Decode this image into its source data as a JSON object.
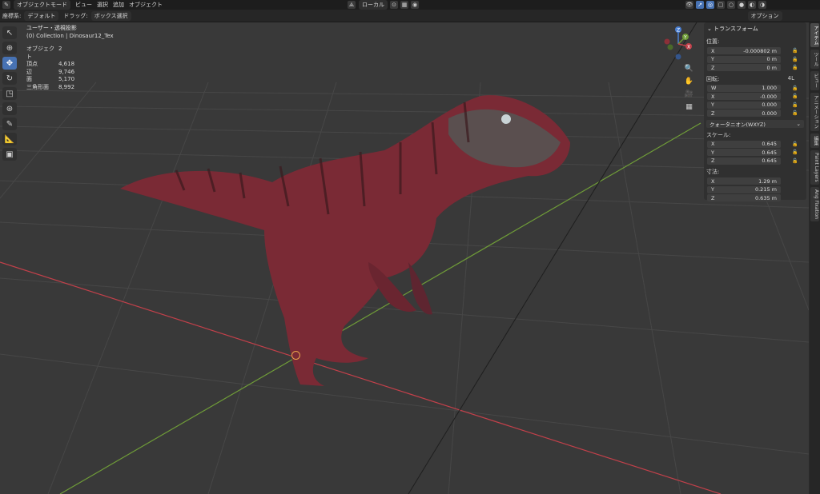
{
  "header": {
    "mode": "オブジェクトモード",
    "menus": [
      "ビュー",
      "選択",
      "追加",
      "オブジェクト"
    ],
    "orientation": "ローカル"
  },
  "header2": {
    "coord_label": "座標系:",
    "coord_value": "デフォルト",
    "drag_label": "ドラッグ:",
    "drag_value": "ボックス選択",
    "options": "オプション"
  },
  "overlay": {
    "view_name": "ユーザー・透視投影",
    "collection": "(0) Collection | Dinosaur12_Tex",
    "stats": [
      {
        "label": "オブジェクト",
        "value": "2"
      },
      {
        "label": "頂点",
        "value": "4,618"
      },
      {
        "label": "辺",
        "value": "9,746"
      },
      {
        "label": "面",
        "value": "5,170"
      },
      {
        "label": "三角形面",
        "value": "8,992"
      }
    ]
  },
  "gizmo": {
    "x": "X",
    "y": "Y",
    "z": "Z"
  },
  "npanel": {
    "title": "トランスフォーム",
    "location_label": "位置:",
    "location": [
      {
        "axis": "X",
        "value": "-0.000802 m"
      },
      {
        "axis": "Y",
        "value": "0 m"
      },
      {
        "axis": "Z",
        "value": "0 m"
      }
    ],
    "rotation_label": "回転:",
    "rotation_mode_tag": "4L",
    "rotation": [
      {
        "axis": "W",
        "value": "1.000"
      },
      {
        "axis": "X",
        "value": "-0.000"
      },
      {
        "axis": "Y",
        "value": "0.000"
      },
      {
        "axis": "Z",
        "value": "0.000"
      }
    ],
    "rotation_mode": "クォータニオン(WXYZ)",
    "scale_label": "スケール:",
    "scale": [
      {
        "axis": "X",
        "value": "0.645"
      },
      {
        "axis": "Y",
        "value": "0.645"
      },
      {
        "axis": "Z",
        "value": "0.645"
      }
    ],
    "dimensions_label": "寸法:",
    "dimensions": [
      {
        "axis": "X",
        "value": "1.29 m"
      },
      {
        "axis": "Y",
        "value": "0.215 m"
      },
      {
        "axis": "Z",
        "value": "0.635 m"
      }
    ]
  },
  "side_tabs": [
    "アイテム",
    "ツール",
    "ビュー",
    "アニメーション",
    "編集",
    "Paint Layers",
    "Ang Fixation"
  ],
  "colors": {
    "accent": "#4772b3",
    "x_axis": "#c2404a",
    "y_axis": "#6f9c38"
  }
}
